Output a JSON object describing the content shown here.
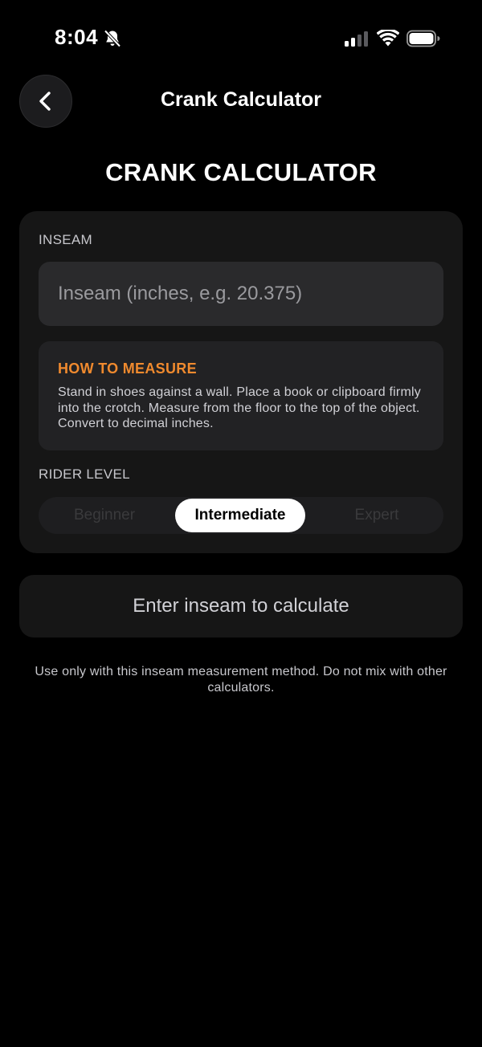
{
  "status_bar": {
    "time": "8:04",
    "icons": [
      "bell-slash-icon",
      "cellular-signal-icon",
      "wifi-icon",
      "battery-icon"
    ]
  },
  "nav": {
    "back_icon": "chevron-left-icon",
    "title": "Crank Calculator"
  },
  "page": {
    "heading": "CRANK CALCULATOR"
  },
  "form": {
    "inseam_label": "INSEAM",
    "inseam_value": "",
    "inseam_placeholder": "Inseam (inches, e.g. 20.375)",
    "how_to_title": "HOW TO MEASURE",
    "how_to_text": "Stand in shoes against a wall. Place a book or clipboard firmly into the crotch. Measure from the floor to the top of the object. Convert to decimal inches.",
    "rider_level_label": "RIDER LEVEL",
    "rider_levels": [
      "Beginner",
      "Intermediate",
      "Expert"
    ],
    "selected_rider_level": "Intermediate"
  },
  "calculate_button": {
    "label": "Enter inseam to calculate"
  },
  "disclaimer": "Use only with this inseam measurement method. Do not mix with other calculators.",
  "colors": {
    "background": "#000000",
    "card": "#161616",
    "input": "#2a2a2c",
    "accent_orange": "#f08a2e",
    "selected_segment": "#ffffff"
  }
}
